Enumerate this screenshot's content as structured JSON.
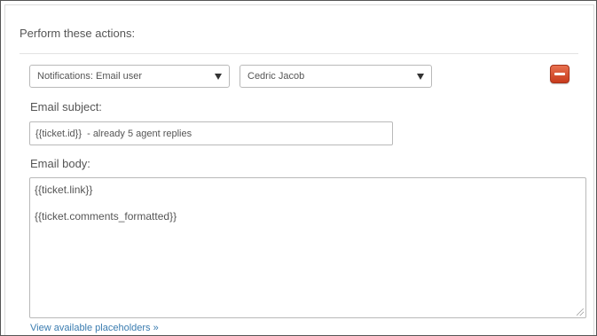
{
  "section": {
    "title": "Perform these actions:"
  },
  "action_row": {
    "action_select": {
      "value": "Notifications: Email user",
      "icon": "chevron-down-icon"
    },
    "user_select": {
      "value": "Cedric Jacob",
      "icon": "chevron-down-icon"
    },
    "remove_button": {
      "icon": "minus-icon",
      "color": "#d9512f"
    }
  },
  "email_subject": {
    "label": "Email subject:",
    "value": "{{ticket.id}}  - already 5 agent replies"
  },
  "email_body": {
    "label": "Email body:",
    "value": "{{ticket.link}}\n\n{{ticket.comments_formatted}}"
  },
  "placeholders_link": {
    "label": "View available placeholders »",
    "color": "#3a7cb0"
  }
}
